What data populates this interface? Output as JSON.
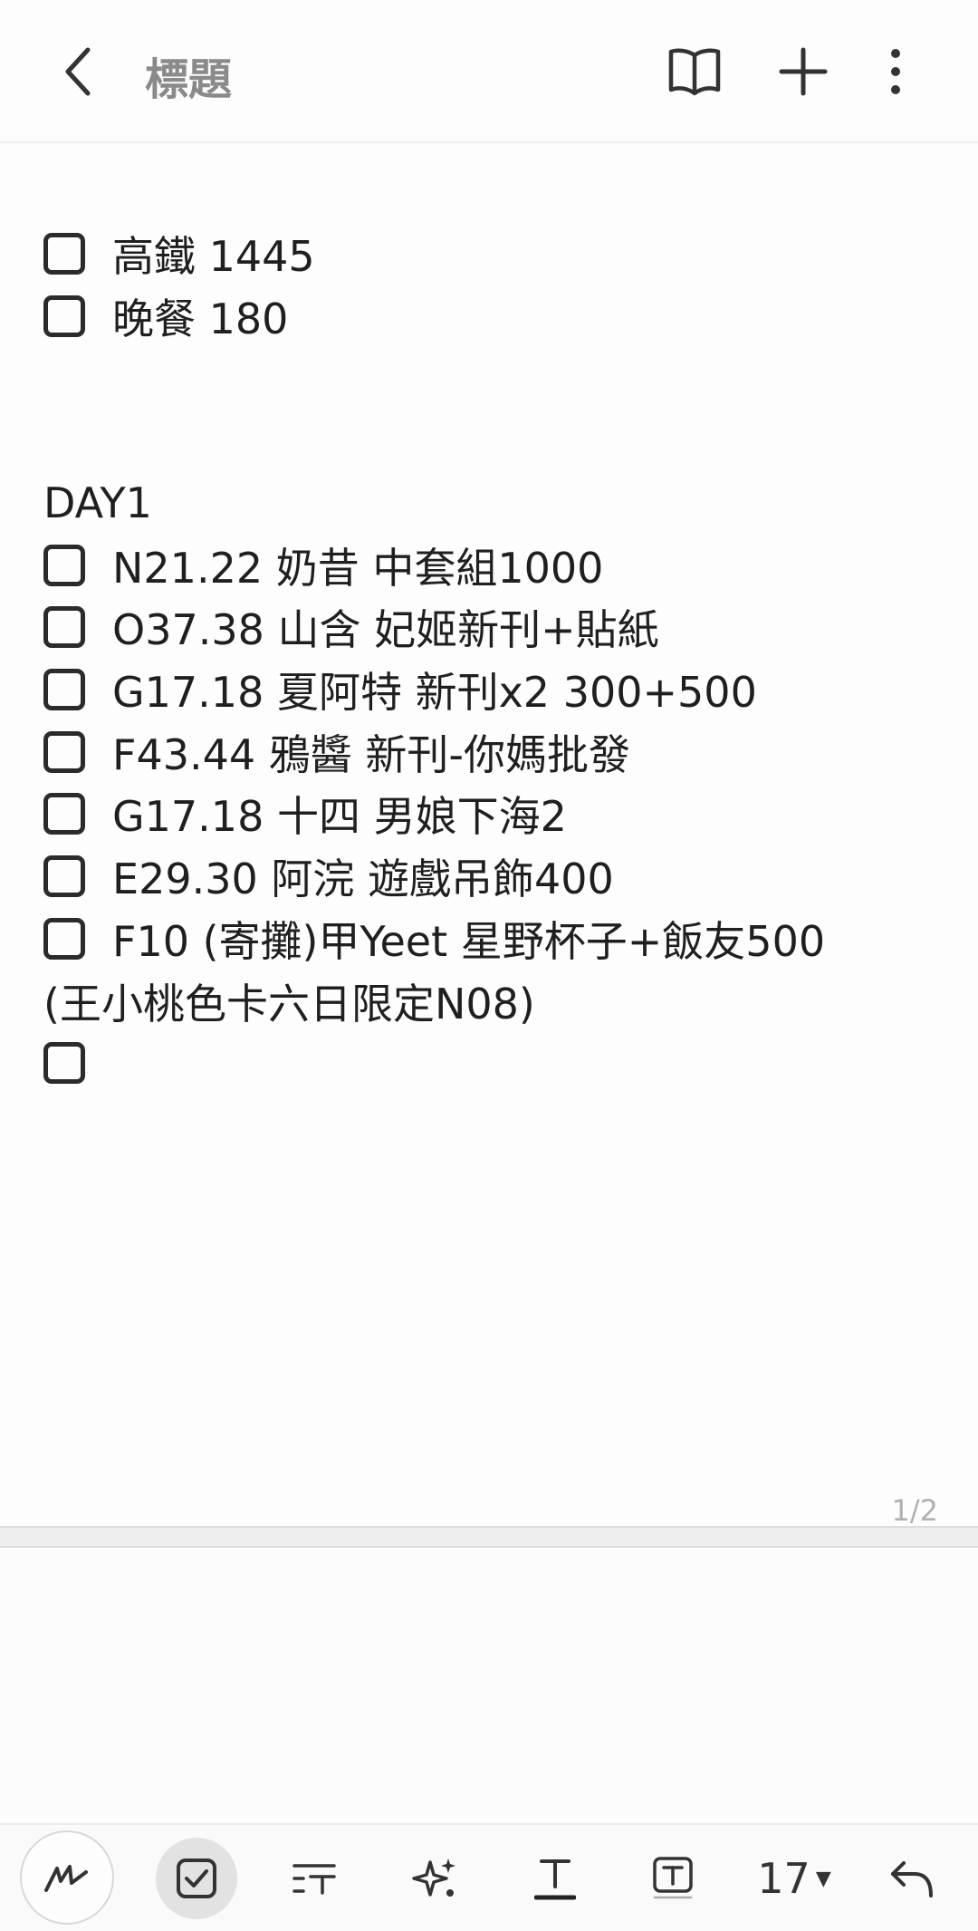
{
  "header": {
    "title": "標題",
    "icons": [
      "back-icon",
      "reading-mode-icon",
      "add-icon",
      "more-icon"
    ]
  },
  "note": {
    "lines": [
      {
        "checkbox": true,
        "text": "高鐵 1445"
      },
      {
        "checkbox": true,
        "text": "晚餐 180"
      },
      {
        "checkbox": false,
        "text": ""
      },
      {
        "checkbox": false,
        "text": ""
      },
      {
        "checkbox": false,
        "text": "DAY1"
      },
      {
        "checkbox": true,
        "text": "N21.22 奶昔 中套組1000"
      },
      {
        "checkbox": true,
        "text": "O37.38 山含 妃姬新刊+貼紙"
      },
      {
        "checkbox": true,
        "text": "G17.18 夏阿特 新刊x2 300+500"
      },
      {
        "checkbox": true,
        "text": "F43.44 鴉醬 新刊-你媽批發"
      },
      {
        "checkbox": true,
        "text": "G17.18 十四 男娘下海2"
      },
      {
        "checkbox": true,
        "text": "E29.30 阿浣 遊戲吊飾400"
      },
      {
        "checkbox": true,
        "text": "F10 (寄攤)甲Yeet 星野杯子+飯友500"
      },
      {
        "checkbox": false,
        "text": "(王小桃色卡六日限定N08)"
      },
      {
        "checkbox": true,
        "text": ""
      }
    ],
    "page_indicator": "1/2"
  },
  "toolbar": {
    "font_size": "17",
    "icons": [
      "pen-icon",
      "checkbox-icon",
      "text-style-icon",
      "sparkle-icon",
      "underline-text-icon",
      "text-box-icon",
      "font-size-dropdown",
      "undo-icon"
    ]
  }
}
